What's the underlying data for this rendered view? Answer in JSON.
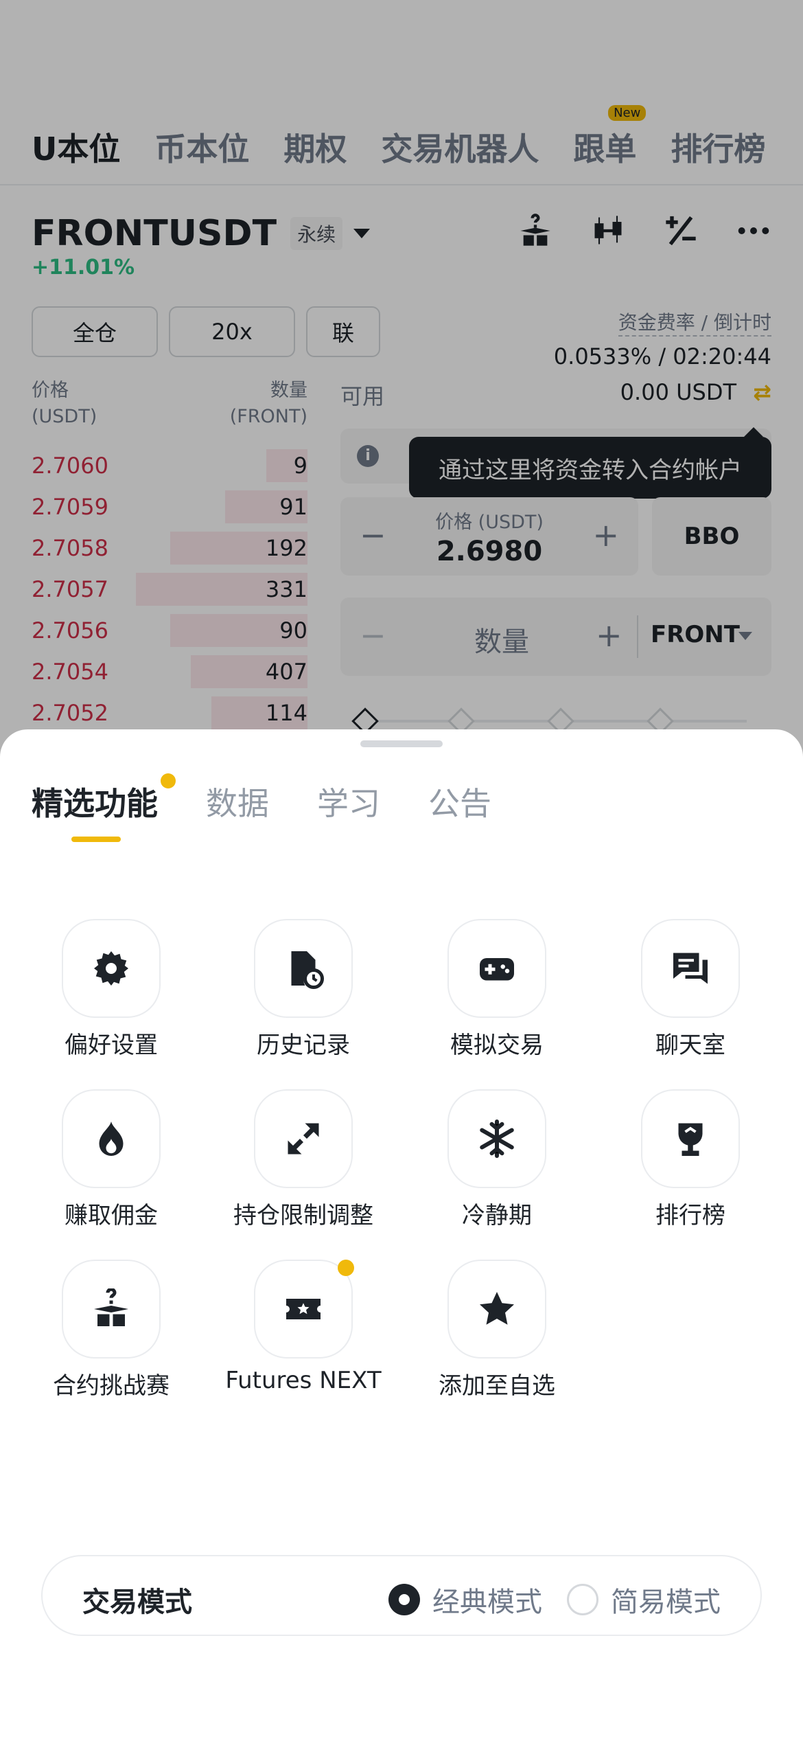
{
  "top_tabs": [
    {
      "label": "U本位",
      "active": true
    },
    {
      "label": "币本位"
    },
    {
      "label": "期权"
    },
    {
      "label": "交易机器人"
    },
    {
      "label": "跟单",
      "badge": "New"
    },
    {
      "label": "排行榜"
    }
  ],
  "ticker": {
    "symbol": "FRONTUSDT",
    "type": "永续",
    "change": "+11.01%"
  },
  "toolbar_icons": [
    "futures-challenge-icon",
    "candlestick-icon",
    "calculator-icon",
    "more-icon"
  ],
  "margin": {
    "mode": "全仓",
    "leverage": "20x",
    "linked": "联"
  },
  "funding": {
    "label": "资金费率 / 倒计时",
    "value": "0.0533% / 02:20:44"
  },
  "orderbook": {
    "price_header": "价格",
    "price_unit": "(USDT)",
    "qty_header": "数量",
    "qty_unit": "(FRONT)",
    "asks": [
      {
        "price": "2.7060",
        "qty": "9"
      },
      {
        "price": "2.7059",
        "qty": "91"
      },
      {
        "price": "2.7058",
        "qty": "192"
      },
      {
        "price": "2.7057",
        "qty": "331"
      },
      {
        "price": "2.7056",
        "qty": "90"
      },
      {
        "price": "2.7054",
        "qty": "407"
      },
      {
        "price": "2.7052",
        "qty": "114"
      }
    ]
  },
  "order_form": {
    "available_label": "可用",
    "available_value": "0.00 USDT",
    "tooltip": "通过这里将资金转入合约帐户",
    "price_label": "价格 (USDT)",
    "price_value": "2.6980",
    "bbo": "BBO",
    "qty_label": "数量",
    "qty_unit": "FRONT",
    "minus": "−",
    "plus": "+"
  },
  "sheet": {
    "tabs": [
      {
        "label": "精选功能",
        "active": true,
        "dot": true
      },
      {
        "label": "数据"
      },
      {
        "label": "学习"
      },
      {
        "label": "公告"
      }
    ],
    "features": [
      {
        "label": "偏好设置",
        "icon": "gear-icon"
      },
      {
        "label": "历史记录",
        "icon": "history-icon"
      },
      {
        "label": "模拟交易",
        "icon": "gamepad-icon"
      },
      {
        "label": "聊天室",
        "icon": "chat-icon"
      },
      {
        "label": "赚取佣金",
        "icon": "flame-icon"
      },
      {
        "label": "持仓限制调整",
        "icon": "expand-icon"
      },
      {
        "label": "冷静期",
        "icon": "snowflake-icon"
      },
      {
        "label": "排行榜",
        "icon": "trophy-icon"
      },
      {
        "label": "合约挑战赛",
        "icon": "mystery-box-icon"
      },
      {
        "label": "Futures NEXT",
        "icon": "ticket-icon",
        "dot": true
      },
      {
        "label": "添加至自选",
        "icon": "star-icon"
      }
    ],
    "trading_mode": {
      "title": "交易模式",
      "options": [
        {
          "label": "经典模式",
          "selected": true
        },
        {
          "label": "简易模式",
          "selected": false
        }
      ]
    }
  },
  "colors": {
    "accent": "#f0b90b",
    "up": "#2ebd85",
    "down": "#cf304a",
    "text": "#1e2329"
  }
}
